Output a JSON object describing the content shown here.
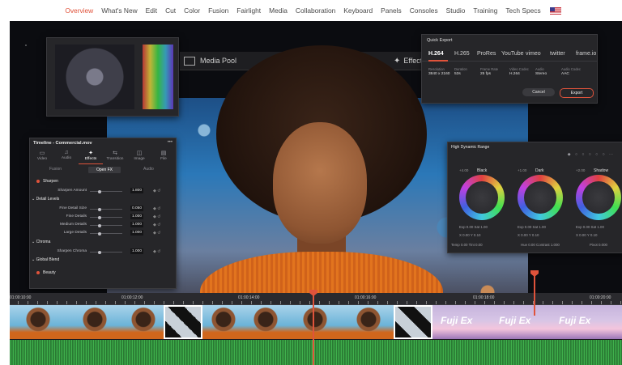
{
  "nav": {
    "items": [
      "Overview",
      "What's New",
      "Edit",
      "Cut",
      "Color",
      "Fusion",
      "Fairlight",
      "Media",
      "Collaboration",
      "Keyboard",
      "Panels",
      "Consoles",
      "Studio",
      "Training",
      "Tech Specs"
    ],
    "active": "Overview",
    "flag_icon": "us-flag-icon"
  },
  "page_bar": {
    "media_pool": "Media Pool",
    "effects": "Effects"
  },
  "quick_export": {
    "title": "Quick Export",
    "codecs": [
      "H.264",
      "H.265",
      "ProRes",
      "YouTube",
      "vimeo",
      "twitter",
      "frame.io"
    ],
    "selected": "H.264",
    "fields": [
      {
        "label": "Resolution",
        "value": "3840 x 2160"
      },
      {
        "label": "Duration",
        "value": "53s"
      },
      {
        "label": "Frame Rate",
        "value": "25 fps"
      },
      {
        "label": "Video Codec",
        "value": "H.264"
      },
      {
        "label": "Audio",
        "value": "Stereo"
      },
      {
        "label": "Audio Codec",
        "value": "AAC"
      }
    ],
    "cancel": "Cancel",
    "export": "Export"
  },
  "inspector": {
    "title": "Timeline - Commercial.mov",
    "tabs": [
      "Video",
      "Audio",
      "Effects",
      "Transition",
      "Image",
      "File"
    ],
    "active_tab": "Effects",
    "subtabs": [
      "Fusion",
      "Open FX",
      "Audio"
    ],
    "active_subtab": "Open FX",
    "sections": {
      "sharpen": "Sharpen",
      "detail_levels": "Detail Levels",
      "chroma": "Chroma",
      "global_blend": "Global Blend",
      "beauty": "Beauty"
    },
    "params": [
      {
        "label": "Sharpen Amount",
        "value": "1.800"
      },
      {
        "label": "Fine Detail Size",
        "value": "0.050"
      },
      {
        "label": "Fine Details",
        "value": "1.000"
      },
      {
        "label": "Medium Details",
        "value": "1.000"
      },
      {
        "label": "Large Details",
        "value": "1.000"
      },
      {
        "label": "Sharpen Chroma",
        "value": "1.000"
      }
    ]
  },
  "hdr": {
    "title": "High Dynamic Range",
    "wheels": [
      {
        "name": "Black",
        "value": "+4.00"
      },
      {
        "name": "Dark",
        "value": "+1.00"
      },
      {
        "name": "Shadow",
        "value": "+2.00"
      }
    ],
    "row1": [
      "Exp",
      "0.00",
      "Sat",
      "1.00"
    ],
    "row2": [
      "X",
      "0.00",
      "Y",
      "0.10"
    ],
    "row3a": [
      "Temp",
      "0.00",
      "Tint",
      "0.00"
    ],
    "row3b": [
      "Hue",
      "0.00",
      "Contrast",
      "1.000"
    ],
    "row3c": [
      "Pivot",
      "0.000"
    ]
  },
  "timeline": {
    "timecodes": [
      "01:00:10:00",
      "01:00:12:00",
      "01:00:14:00",
      "01:00:16:00",
      "01:00:18:00",
      "01:00:20:00"
    ],
    "fuji_text": "Fuji Ex"
  }
}
